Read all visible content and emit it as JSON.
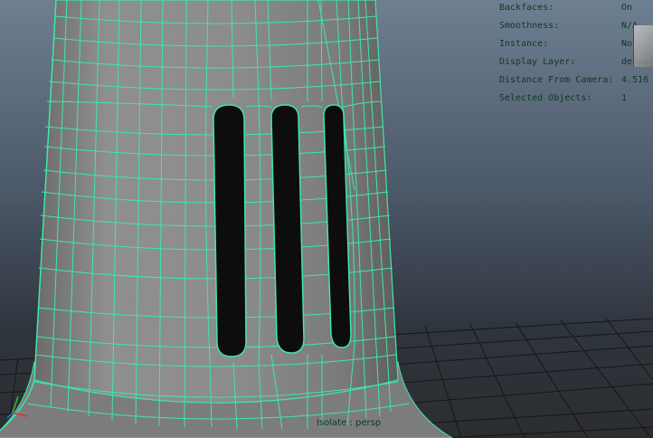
{
  "viewport": {
    "camera": "persp",
    "isolate_label": "Isolate : persp"
  },
  "hud": [
    {
      "label": "Backfaces:",
      "value": "On"
    },
    {
      "label": "Smoothness:",
      "value": "N/A"
    },
    {
      "label": "Instance:",
      "value": "No"
    },
    {
      "label": "Display Layer:",
      "value": "default"
    },
    {
      "label": "Distance From Camera:",
      "value": "4.516"
    },
    {
      "label": "Selected Objects:",
      "value": "1"
    }
  ],
  "colors": {
    "wireframe": "#3ee8a8",
    "mesh_shade": "#8a8a8a",
    "slot": "#0d0d0d",
    "hud_text": "#0b3b20",
    "grid": "#1b1b1b"
  },
  "icons": {
    "view_cube": "view-cube-icon",
    "axis": "axis-gizmo-icon"
  }
}
